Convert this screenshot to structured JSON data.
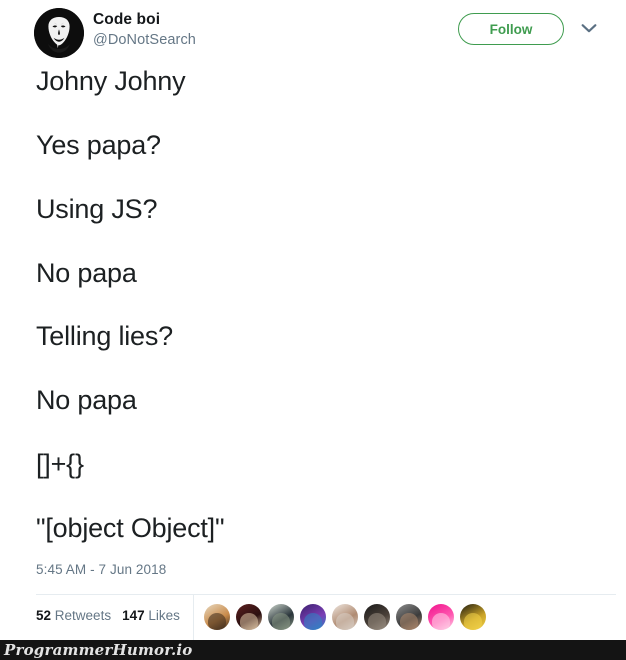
{
  "tweet": {
    "author_name": "Code boi",
    "author_handle": "@DoNotSearch",
    "avatar_icon": "anonymous-mask-icon",
    "follow_label": "Follow",
    "caret_icon": "chevron-down-icon",
    "lines": [
      "Johny Johny",
      "Yes papa?",
      "Using JS?",
      "No papa",
      "Telling lies?",
      "No papa",
      "[]+{}",
      "\"[object Object]\""
    ],
    "timestamp": "5:45 AM - 7 Jun 2018",
    "stats": {
      "retweets_count": "52",
      "retweets_label": "Retweets",
      "likes_count": "147",
      "likes_label": "Likes"
    },
    "liker_avatars": [
      {
        "name": "liker-avatar-1",
        "c1": "#e8d9bf",
        "c2": "#c98b4b",
        "c3": "#3a2a1c"
      },
      {
        "name": "liker-avatar-2",
        "c1": "#5c1f1f",
        "c2": "#2b1010",
        "c3": "#e2c9a8"
      },
      {
        "name": "liker-avatar-3",
        "c1": "#cfd8cf",
        "c2": "#29343a",
        "c3": "#8c9a86"
      },
      {
        "name": "liker-avatar-4",
        "c1": "#3b1f6e",
        "c2": "#7b3fb5",
        "c3": "#2b86c5"
      },
      {
        "name": "liker-avatar-5",
        "c1": "#efe7e0",
        "c2": "#b08b72",
        "c3": "#d9cfc6"
      },
      {
        "name": "liker-avatar-6",
        "c1": "#1b1b1b",
        "c2": "#4a4038",
        "c3": "#9a8f83"
      },
      {
        "name": "liker-avatar-7",
        "c1": "#8e8e8e",
        "c2": "#3b3b3b",
        "c3": "#b08a6e"
      },
      {
        "name": "liker-avatar-8",
        "c1": "#f0128c",
        "c2": "#ff57b0",
        "c3": "#ffd6ea"
      },
      {
        "name": "liker-avatar-9",
        "c1": "#1d1a10",
        "c2": "#c9a227",
        "c3": "#f2d34a"
      }
    ]
  },
  "watermark": {
    "text": "ProgrammerHumor.io"
  },
  "colors": {
    "follow_green": "#3f9c4f",
    "text_dark": "#1c2022",
    "text_muted": "#657786",
    "divider": "#e6ecf0",
    "watermark_bar": "#141414"
  }
}
